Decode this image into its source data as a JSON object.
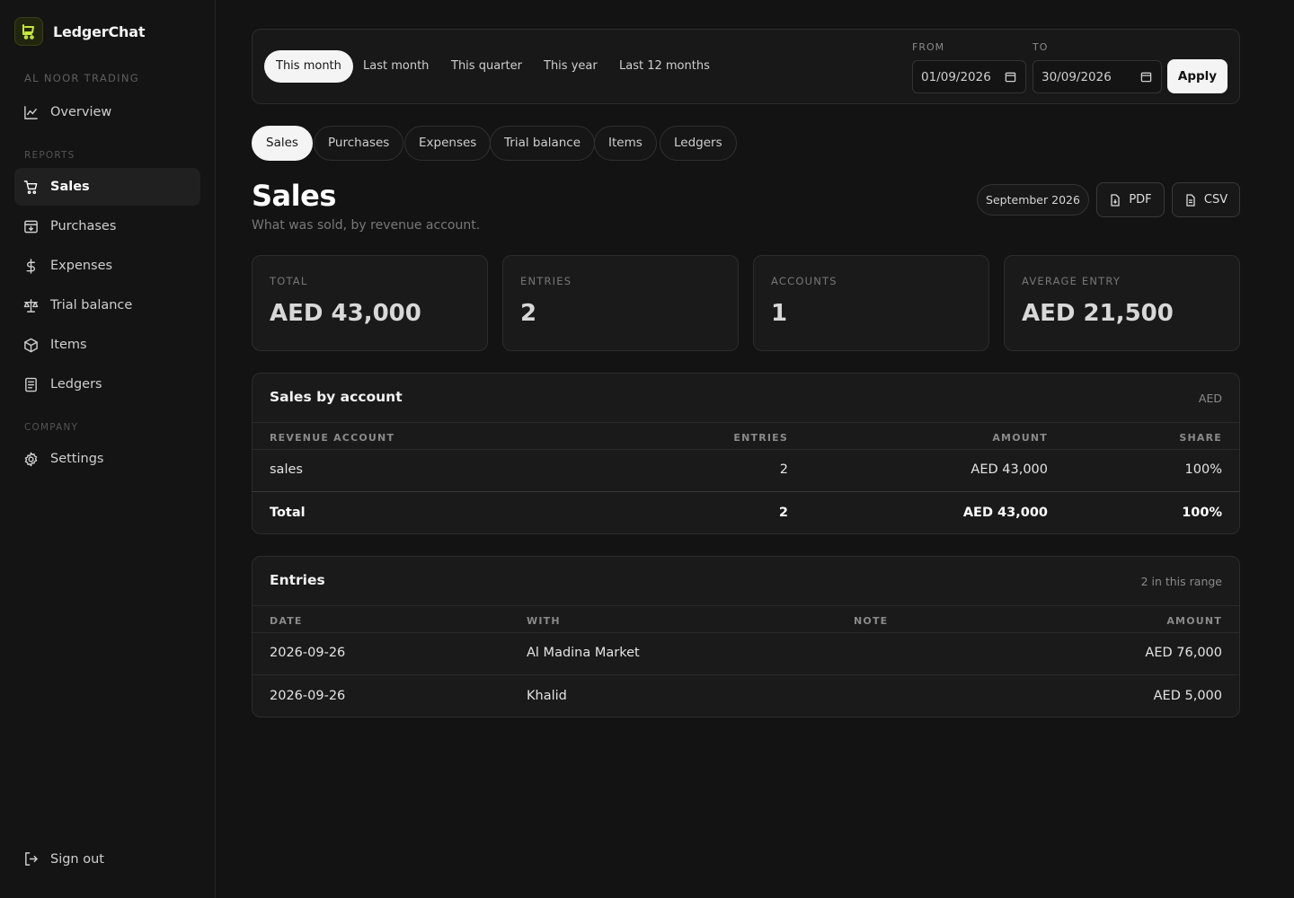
{
  "app": {
    "name": "LedgerChat",
    "org": "AL NOOR TRADING"
  },
  "sidebar": {
    "overview": "Overview",
    "reports_label": "REPORTS",
    "reports": [
      {
        "label": "Sales",
        "icon": "cart-icon",
        "active": true
      },
      {
        "label": "Purchases",
        "icon": "box-in-icon"
      },
      {
        "label": "Expenses",
        "icon": "dollar-icon"
      },
      {
        "label": "Trial balance",
        "icon": "scale-icon"
      },
      {
        "label": "Items",
        "icon": "cube-icon"
      },
      {
        "label": "Ledgers",
        "icon": "book-icon"
      }
    ],
    "company_label": "COMPANY",
    "settings": "Settings",
    "signout": "Sign out"
  },
  "filters": {
    "ranges": [
      "This month",
      "Last month",
      "This quarter",
      "This year",
      "Last 12 months"
    ],
    "active_range": "This month",
    "from_label": "FROM",
    "from_value": "01/09/2026",
    "to_label": "TO",
    "to_value": "30/09/2026",
    "apply": "Apply"
  },
  "tabs": [
    "Sales",
    "Purchases",
    "Expenses",
    "Trial balance",
    "Items",
    "Ledgers"
  ],
  "page": {
    "title": "Sales",
    "subtitle": "What was sold, by revenue account.",
    "period": "September 2026",
    "pdf": "PDF",
    "csv": "CSV"
  },
  "stats": [
    {
      "label": "TOTAL",
      "value": "AED 43,000"
    },
    {
      "label": "ENTRIES",
      "value": "2"
    },
    {
      "label": "ACCOUNTS",
      "value": "1"
    },
    {
      "label": "AVERAGE ENTRY",
      "value": "AED 21,500"
    }
  ],
  "by_account": {
    "title": "Sales by account",
    "currency": "AED",
    "headers": [
      "REVENUE ACCOUNT",
      "ENTRIES",
      "AMOUNT",
      "SHARE"
    ],
    "rows": [
      [
        "sales",
        "2",
        "AED 43,000",
        "100%"
      ]
    ],
    "total": [
      "Total",
      "2",
      "AED 43,000",
      "100%"
    ]
  },
  "entries": {
    "title": "Entries",
    "meta": "2 in this range",
    "headers": [
      "DATE",
      "WITH",
      "NOTE",
      "AMOUNT"
    ],
    "rows": [
      [
        "2026-09-26",
        "Al Madina Market",
        "",
        "AED 76,000"
      ],
      [
        "2026-09-26",
        "Khalid",
        "",
        "AED 5,000"
      ]
    ]
  }
}
